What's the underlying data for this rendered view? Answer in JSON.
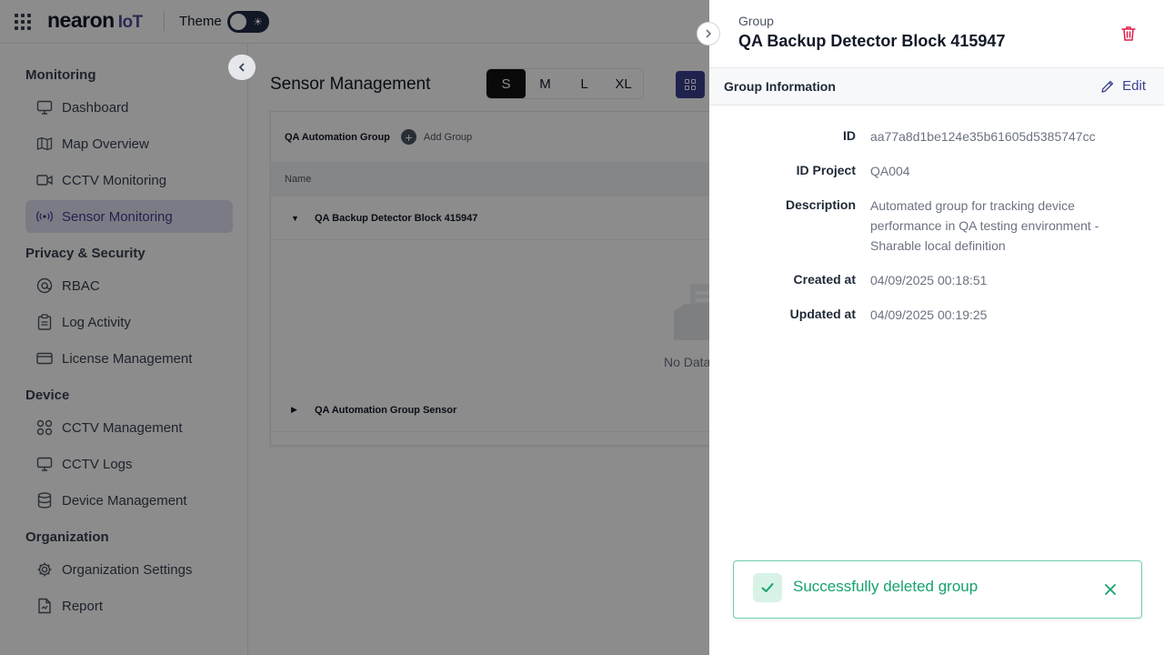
{
  "topbar": {
    "brand": "nearon",
    "brand_suffix": "IoT",
    "theme_label": "Theme",
    "theme_icon": "sun-icon"
  },
  "sidebar": {
    "sections": [
      {
        "title": "Monitoring",
        "items": [
          {
            "label": "Dashboard",
            "icon": "monitor-icon"
          },
          {
            "label": "Map Overview",
            "icon": "map-icon"
          },
          {
            "label": "CCTV Monitoring",
            "icon": "video-icon"
          },
          {
            "label": "Sensor Monitoring",
            "icon": "broadcast-icon",
            "active": true
          }
        ]
      },
      {
        "title": "Privacy & Security",
        "items": [
          {
            "label": "RBAC",
            "icon": "at-icon"
          },
          {
            "label": "Log Activity",
            "icon": "clipboard-icon"
          },
          {
            "label": "License Management",
            "icon": "card-icon"
          }
        ]
      },
      {
        "title": "Device",
        "items": [
          {
            "label": "CCTV Management",
            "icon": "grid-icon"
          },
          {
            "label": "CCTV Logs",
            "icon": "monitor-icon"
          },
          {
            "label": "Device Management",
            "icon": "database-icon"
          }
        ]
      },
      {
        "title": "Organization",
        "items": [
          {
            "label": "Organization Settings",
            "icon": "gear-icon"
          },
          {
            "label": "Report",
            "icon": "file-icon"
          }
        ]
      }
    ]
  },
  "main": {
    "title": "Sensor Management",
    "sizes": [
      "S",
      "M",
      "L",
      "XL"
    ],
    "active_size": "S",
    "group_tab": "QA Automation Group",
    "add_group": "Add Group",
    "column_name": "Name",
    "rows": [
      {
        "name": "QA Backup Detector Block 415947",
        "expanded": true
      },
      {
        "name": "QA Automation Group Sensor",
        "expanded": false
      }
    ],
    "empty_text": "No Data"
  },
  "drawer": {
    "subtitle": "Group",
    "title": "QA Backup Detector Block 415947",
    "section_title": "Group Information",
    "edit_label": "Edit",
    "fields": [
      {
        "label": "ID",
        "value": "aa77a8d1be124e35b61605d5385747cc"
      },
      {
        "label": "ID Project",
        "value": "QA004"
      },
      {
        "label": "Description",
        "value": "Automated group for tracking device performance in QA testing environment - Sharable local definition"
      },
      {
        "label": "Created at",
        "value": "04/09/2025 00:18:51"
      },
      {
        "label": "Updated at",
        "value": "04/09/2025 00:19:25"
      }
    ]
  },
  "toast": {
    "message": "Successfully deleted group",
    "status_color": "#16a36b"
  },
  "colors": {
    "accent": "#3b3f8f",
    "danger": "#e11d48",
    "success": "#16a36b"
  }
}
